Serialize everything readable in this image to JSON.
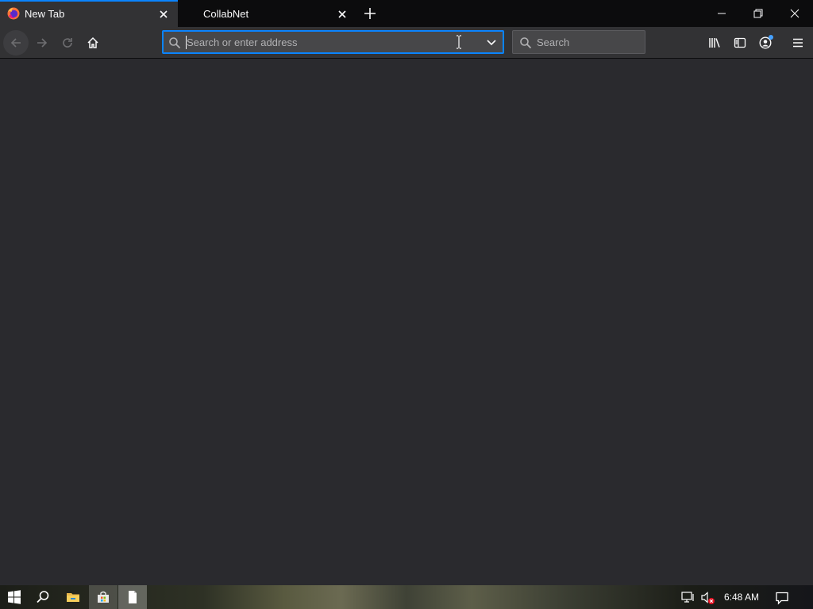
{
  "browser": {
    "tabs": [
      {
        "title": "New Tab",
        "active": true
      },
      {
        "title": "CollabNet",
        "active": false
      }
    ]
  },
  "toolbar": {
    "url_placeholder": "Search or enter address",
    "search_placeholder": "Search"
  },
  "taskbar": {
    "clock": "6:48 AM"
  },
  "colors": {
    "accent": "#0a84ff",
    "chrome": "#323234",
    "content_bg": "#2a2a2e"
  },
  "icons": {
    "tab": [
      "firefox-icon",
      "close-icon"
    ],
    "toolbar": [
      "back-icon",
      "forward-icon",
      "reload-icon",
      "home-icon",
      "search-icon",
      "chevron-down-icon",
      "library-icon",
      "sidebar-icon",
      "account-icon",
      "hamburger-menu-icon"
    ],
    "taskbar": [
      "windows-start-icon",
      "search-icon",
      "file-explorer-icon",
      "store-icon",
      "document-icon",
      "network-icon",
      "volume-muted-icon",
      "notification-icon"
    ]
  }
}
